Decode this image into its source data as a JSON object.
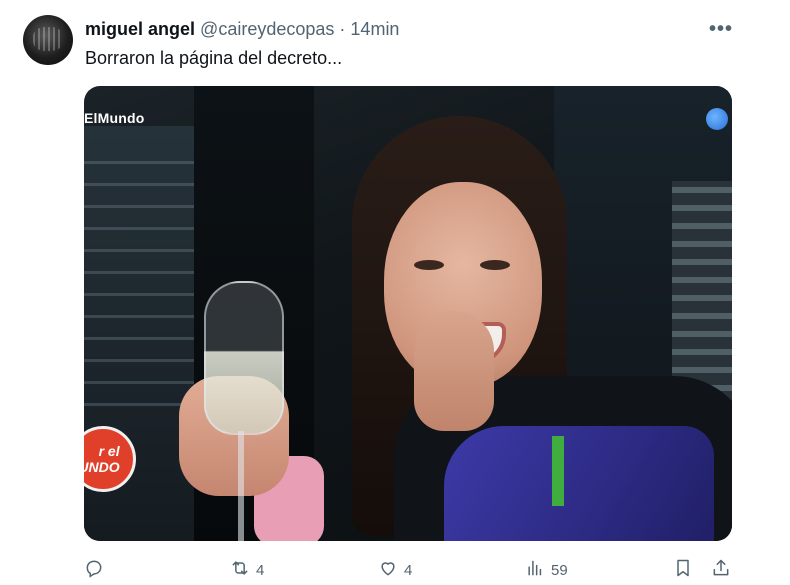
{
  "tweet": {
    "author_name": "miguel angel",
    "handle": "@caireydecopas",
    "separator": "·",
    "time": "14min",
    "text": "Borraron la página del decreto...",
    "more_label": "•••"
  },
  "media": {
    "channel_logo": "ElMundo",
    "badge_text": "r el\nUNDO"
  },
  "actions": {
    "reply": {
      "icon": "reply-icon",
      "count": ""
    },
    "retweet": {
      "icon": "retweet-icon",
      "count": "4"
    },
    "like": {
      "icon": "heart-icon",
      "count": "4"
    },
    "views": {
      "icon": "views-icon",
      "count": "59"
    },
    "bookmark": {
      "icon": "bookmark-icon",
      "count": ""
    },
    "share": {
      "icon": "share-icon",
      "count": ""
    }
  },
  "colors": {
    "text_primary": "#0f1419",
    "text_secondary": "#536471",
    "badge_red": "#e0402a"
  }
}
